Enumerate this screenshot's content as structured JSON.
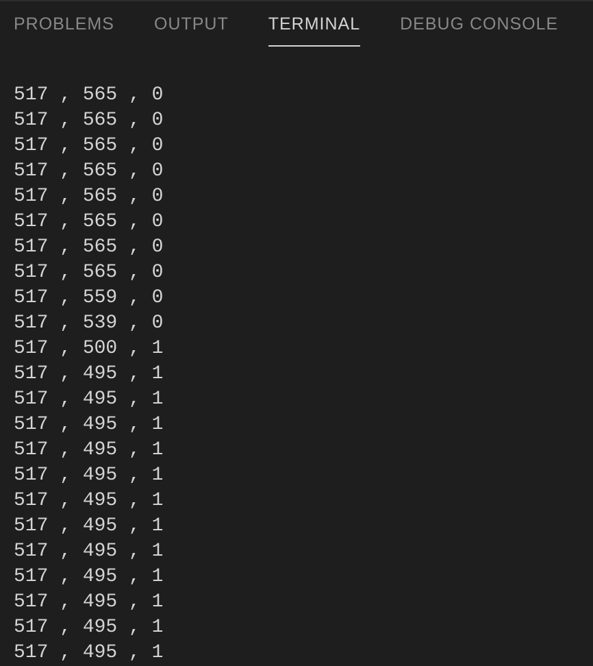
{
  "tabs": {
    "problems": "PROBLEMS",
    "output": "OUTPUT",
    "terminal": "TERMINAL",
    "debug_console": "DEBUG CONSOLE"
  },
  "active_tab": "terminal",
  "terminal_lines": [
    "517 , 565 , 0",
    "517 , 565 , 0",
    "517 , 565 , 0",
    "517 , 565 , 0",
    "517 , 565 , 0",
    "517 , 565 , 0",
    "517 , 565 , 0",
    "517 , 565 , 0",
    "517 , 559 , 0",
    "517 , 539 , 0",
    "517 , 500 , 1",
    "517 , 495 , 1",
    "517 , 495 , 1",
    "517 , 495 , 1",
    "517 , 495 , 1",
    "517 , 495 , 1",
    "517 , 495 , 1",
    "517 , 495 , 1",
    "517 , 495 , 1",
    "517 , 495 , 1",
    "517 , 495 , 1",
    "517 , 495 , 1",
    "517 , 495 , 1"
  ]
}
